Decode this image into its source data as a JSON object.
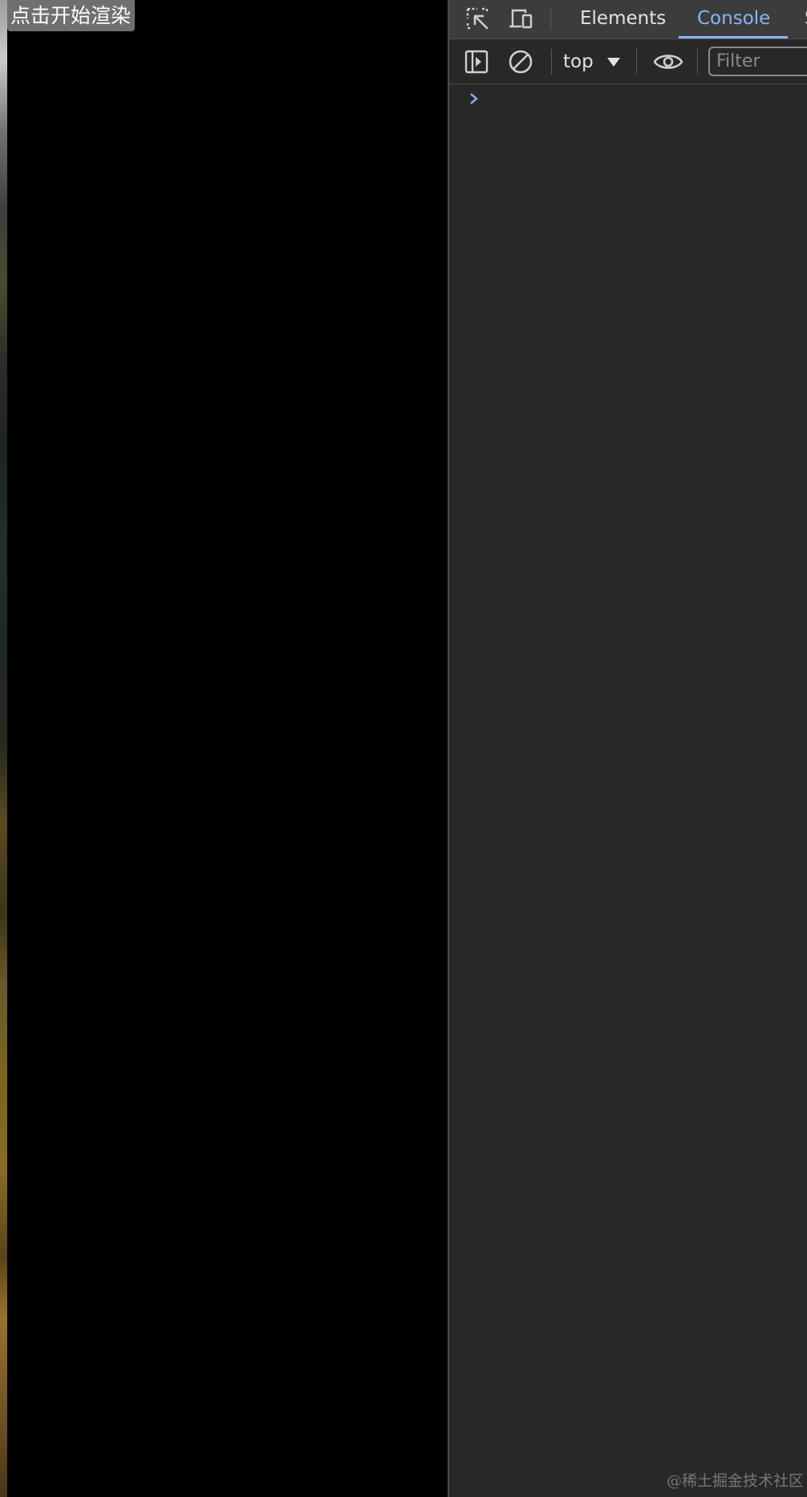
{
  "viewport": {
    "render_button_label": "点击开始渲染"
  },
  "devtools": {
    "tabs": [
      {
        "label": "Elements",
        "active": false
      },
      {
        "label": "Console",
        "active": true
      },
      {
        "label": "S",
        "active": false
      }
    ],
    "icons": {
      "inspect": "inspect-element-icon",
      "device": "device-toolbar-icon",
      "sidebar": "sidebar-toggle-icon",
      "clear": "clear-console-icon",
      "eye": "live-expression-eye-icon",
      "prompt": "console-prompt-chevron-icon"
    },
    "toolbar": {
      "context": "top",
      "filter_placeholder": "Filter"
    },
    "colors": {
      "accent": "#8ab4f8",
      "panel_bg": "#282828",
      "tabbar_bg": "#3c3c3c"
    }
  },
  "watermark": "@稀土掘金技术社区"
}
